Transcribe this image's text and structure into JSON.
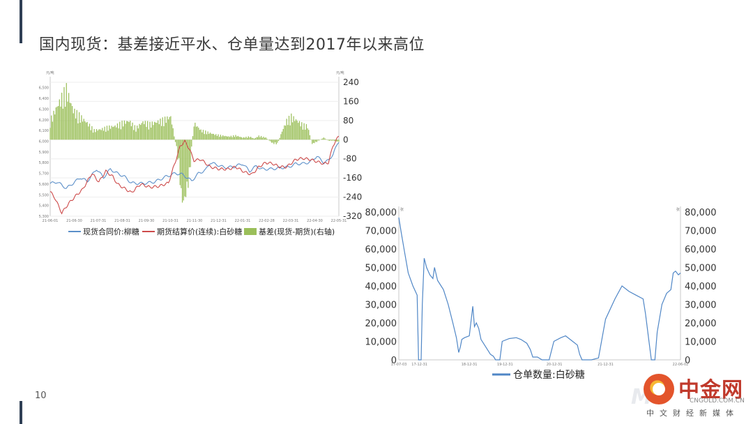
{
  "slide": {
    "title": "国内现货：基差接近平水、仓单量达到2017年以来高位",
    "page_number": "10"
  },
  "watermark": {
    "brand": "中金网",
    "url": "CNGOLD.COM.CN",
    "tagline": "中文财经新媒体"
  },
  "chart_data": [
    {
      "type": "line",
      "title": "",
      "left_unit": "元/吨",
      "right_unit": "元/吨",
      "ylim_left": [
        5300,
        6550
      ],
      "ylim_right": [
        -320,
        240
      ],
      "left_ticks": [
        "6,500",
        "6,400",
        "6,300",
        "6,200",
        "6,100",
        "6,000",
        "5,900",
        "5,800",
        "5,700",
        "5,600",
        "5,500",
        "5,400",
        "5,300"
      ],
      "right_ticks": [
        "240",
        "160",
        "80",
        "0",
        "-80",
        "-160",
        "-240",
        "-320"
      ],
      "x_ticks": [
        "21-06-01",
        "21-06-30",
        "21-07-31",
        "21-08-31",
        "21-09-30",
        "21-10-31",
        "21-11-30",
        "21-12-31",
        "22-01-31",
        "22-02-28",
        "22-03-31",
        "22-04-30",
        "22-05-31"
      ],
      "x_count": 250,
      "series": [
        {
          "name": "现货合同价:柳糖",
          "color": "#5b8fc9",
          "axis": "left",
          "points": [
            [
              0,
              5605
            ],
            [
              6,
              5620
            ],
            [
              14,
              5560
            ],
            [
              20,
              5610
            ],
            [
              26,
              5660
            ],
            [
              32,
              5625
            ],
            [
              40,
              5740
            ],
            [
              46,
              5660
            ],
            [
              52,
              5740
            ],
            [
              56,
              5710
            ],
            [
              64,
              5670
            ],
            [
              70,
              5610
            ],
            [
              80,
              5605
            ],
            [
              90,
              5620
            ],
            [
              100,
              5670
            ],
            [
              108,
              5700
            ],
            [
              114,
              5690
            ],
            [
              122,
              5630
            ],
            [
              128,
              5700
            ],
            [
              134,
              5730
            ],
            [
              138,
              5800
            ],
            [
              144,
              5780
            ],
            [
              150,
              5755
            ],
            [
              158,
              5760
            ],
            [
              166,
              5790
            ],
            [
              172,
              5720
            ],
            [
              178,
              5770
            ],
            [
              182,
              5740
            ],
            [
              190,
              5740
            ],
            [
              198,
              5750
            ],
            [
              206,
              5760
            ],
            [
              212,
              5790
            ],
            [
              218,
              5790
            ],
            [
              224,
              5805
            ],
            [
              230,
              5860
            ],
            [
              236,
              5800
            ],
            [
              240,
              5820
            ],
            [
              244,
              5880
            ],
            [
              249,
              6000
            ]
          ]
        },
        {
          "name": "期货结算价(连续):白砂糖",
          "color": "#cd4a4a",
          "axis": "left",
          "points": [
            [
              0,
              5530
            ],
            [
              4,
              5470
            ],
            [
              10,
              5330
            ],
            [
              16,
              5420
            ],
            [
              22,
              5490
            ],
            [
              28,
              5550
            ],
            [
              36,
              5700
            ],
            [
              42,
              5620
            ],
            [
              48,
              5720
            ],
            [
              54,
              5670
            ],
            [
              58,
              5600
            ],
            [
              64,
              5560
            ],
            [
              70,
              5520
            ],
            [
              78,
              5600
            ],
            [
              86,
              5570
            ],
            [
              94,
              5580
            ],
            [
              102,
              5610
            ],
            [
              108,
              5810
            ],
            [
              112,
              5950
            ],
            [
              116,
              6000
            ],
            [
              120,
              5930
            ],
            [
              124,
              5820
            ],
            [
              130,
              5830
            ],
            [
              138,
              5760
            ],
            [
              146,
              5740
            ],
            [
              154,
              5740
            ],
            [
              160,
              5760
            ],
            [
              168,
              5710
            ],
            [
              174,
              5690
            ],
            [
              180,
              5760
            ],
            [
              186,
              5800
            ],
            [
              192,
              5790
            ],
            [
              198,
              5760
            ],
            [
              204,
              5760
            ],
            [
              212,
              5830
            ],
            [
              218,
              5840
            ],
            [
              224,
              5830
            ],
            [
              230,
              5810
            ],
            [
              236,
              5790
            ],
            [
              240,
              5800
            ],
            [
              244,
              5960
            ],
            [
              249,
              6050
            ]
          ]
        }
      ],
      "bars": {
        "name": "基差(现货-期货)(右轴)",
        "color": "#9bbf5a",
        "axis": "right",
        "points": [
          [
            0,
            90
          ],
          [
            6,
            160
          ],
          [
            10,
            200
          ],
          [
            14,
            240
          ],
          [
            20,
            140
          ],
          [
            26,
            110
          ],
          [
            32,
            80
          ],
          [
            38,
            45
          ],
          [
            44,
            50
          ],
          [
            50,
            60
          ],
          [
            56,
            65
          ],
          [
            62,
            80
          ],
          [
            68,
            90
          ],
          [
            74,
            55
          ],
          [
            80,
            85
          ],
          [
            86,
            75
          ],
          [
            92,
            85
          ],
          [
            98,
            95
          ],
          [
            104,
            110
          ],
          [
            108,
            -10
          ],
          [
            111,
            -120
          ],
          [
            113,
            -270
          ],
          [
            115,
            -300
          ],
          [
            117,
            -260
          ],
          [
            120,
            -180
          ],
          [
            124,
            80
          ],
          [
            130,
            45
          ],
          [
            136,
            35
          ],
          [
            142,
            25
          ],
          [
            148,
            20
          ],
          [
            154,
            15
          ],
          [
            160,
            20
          ],
          [
            166,
            10
          ],
          [
            172,
            15
          ],
          [
            176,
            5
          ],
          [
            180,
            18
          ],
          [
            186,
            10
          ],
          [
            192,
            -18
          ],
          [
            196,
            -20
          ],
          [
            200,
            40
          ],
          [
            204,
            90
          ],
          [
            208,
            110
          ],
          [
            212,
            95
          ],
          [
            218,
            70
          ],
          [
            222,
            65
          ],
          [
            226,
            -20
          ],
          [
            230,
            -10
          ],
          [
            236,
            10
          ],
          [
            240,
            -5
          ],
          [
            244,
            -5
          ],
          [
            249,
            -10
          ]
        ]
      },
      "legend": [
        "现货合同价:柳糖",
        "期货结算价(连续):白砂糖",
        "基差(现货-期货)(右轴)"
      ]
    },
    {
      "type": "line",
      "title": "",
      "left_unit": "张",
      "right_unit": "张",
      "ylim": [
        0,
        80000
      ],
      "left_ticks": [
        "80,000",
        "70,000",
        "60,000",
        "50,000",
        "40,000",
        "30,000",
        "20,000",
        "10,000",
        "0"
      ],
      "right_ticks": [
        "80,000",
        "70,000",
        "60,000",
        "50,000",
        "40,000",
        "30,000",
        "20,000",
        "10,000",
        "0"
      ],
      "x_ticks": [
        "17-07-03",
        "17-12-31",
        "18-12-31",
        "19-12-31",
        "20-12-31",
        "21-12-31",
        "22-06-02"
      ],
      "x_count": 1200,
      "series": [
        {
          "name": "仓单数量:白砂糖",
          "color": "#4f86c6",
          "points": [
            [
              0,
              77000
            ],
            [
              10,
              69000
            ],
            [
              25,
              58000
            ],
            [
              40,
              47000
            ],
            [
              60,
              40000
            ],
            [
              78,
              35000
            ],
            [
              84,
              0
            ],
            [
              95,
              0
            ],
            [
              100,
              30000
            ],
            [
              108,
              55000
            ],
            [
              118,
              50000
            ],
            [
              132,
              46000
            ],
            [
              145,
              44000
            ],
            [
              152,
              50000
            ],
            [
              165,
              43000
            ],
            [
              190,
              38000
            ],
            [
              210,
              30000
            ],
            [
              230,
              20000
            ],
            [
              245,
              12000
            ],
            [
              255,
              4000
            ],
            [
              262,
              7000
            ],
            [
              268,
              11000
            ],
            [
              280,
              12000
            ],
            [
              300,
              13000
            ],
            [
              315,
              29000
            ],
            [
              322,
              18000
            ],
            [
              330,
              20000
            ],
            [
              340,
              17000
            ],
            [
              350,
              11000
            ],
            [
              370,
              7000
            ],
            [
              390,
              3000
            ],
            [
              402,
              2000
            ],
            [
              412,
              0
            ],
            [
              430,
              0
            ],
            [
              440,
              10000
            ],
            [
              470,
              11500
            ],
            [
              500,
              12000
            ],
            [
              520,
              11000
            ],
            [
              545,
              9000
            ],
            [
              560,
              5500
            ],
            [
              570,
              1500
            ],
            [
              590,
              1500
            ],
            [
              610,
              0
            ],
            [
              640,
              0
            ],
            [
              660,
              10000
            ],
            [
              690,
              12000
            ],
            [
              710,
              13000
            ],
            [
              740,
              10000
            ],
            [
              760,
              8000
            ],
            [
              770,
              3000
            ],
            [
              780,
              0
            ],
            [
              820,
              0
            ],
            [
              850,
              1000
            ],
            [
              880,
              22000
            ],
            [
              920,
              33000
            ],
            [
              950,
              40000
            ],
            [
              980,
              37000
            ],
            [
              1010,
              35000
            ],
            [
              1040,
              33000
            ],
            [
              1050,
              25000
            ],
            [
              1065,
              10000
            ],
            [
              1075,
              0
            ],
            [
              1090,
              0
            ],
            [
              1100,
              15000
            ],
            [
              1120,
              30000
            ],
            [
              1140,
              36000
            ],
            [
              1158,
              38000
            ],
            [
              1168,
              47000
            ],
            [
              1178,
              48000
            ],
            [
              1190,
              46000
            ],
            [
              1199,
              47000
            ]
          ]
        }
      ],
      "legend": [
        "仓单数量:白砂糖"
      ]
    }
  ]
}
